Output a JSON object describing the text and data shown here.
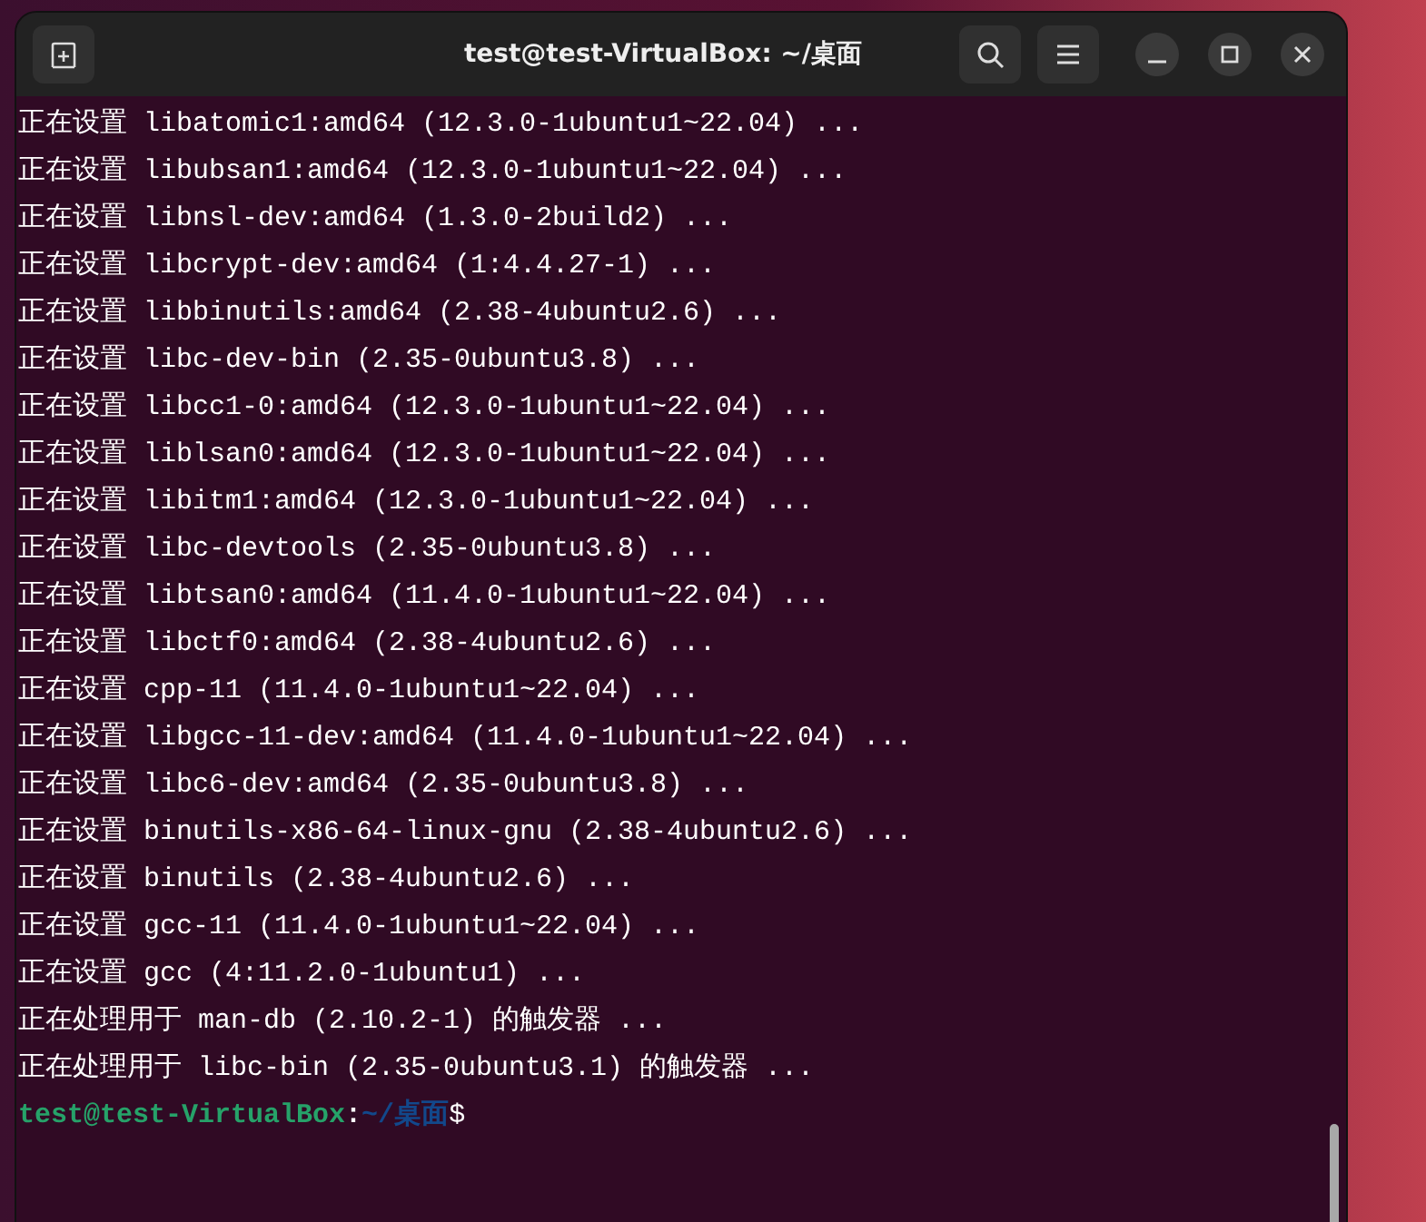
{
  "window": {
    "title": "test@test-VirtualBox: ~/桌面"
  },
  "terminal": {
    "lines": [
      "正在设置 libatomic1:amd64 (12.3.0-1ubuntu1~22.04) ...",
      "正在设置 libubsan1:amd64 (12.3.0-1ubuntu1~22.04) ...",
      "正在设置 libnsl-dev:amd64 (1.3.0-2build2) ...",
      "正在设置 libcrypt-dev:amd64 (1:4.4.27-1) ...",
      "正在设置 libbinutils:amd64 (2.38-4ubuntu2.6) ...",
      "正在设置 libc-dev-bin (2.35-0ubuntu3.8) ...",
      "正在设置 libcc1-0:amd64 (12.3.0-1ubuntu1~22.04) ...",
      "正在设置 liblsan0:amd64 (12.3.0-1ubuntu1~22.04) ...",
      "正在设置 libitm1:amd64 (12.3.0-1ubuntu1~22.04) ...",
      "正在设置 libc-devtools (2.35-0ubuntu3.8) ...",
      "正在设置 libtsan0:amd64 (11.4.0-1ubuntu1~22.04) ...",
      "正在设置 libctf0:amd64 (2.38-4ubuntu2.6) ...",
      "正在设置 cpp-11 (11.4.0-1ubuntu1~22.04) ...",
      "正在设置 libgcc-11-dev:amd64 (11.4.0-1ubuntu1~22.04) ...",
      "正在设置 libc6-dev:amd64 (2.35-0ubuntu3.8) ...",
      "正在设置 binutils-x86-64-linux-gnu (2.38-4ubuntu2.6) ...",
      "正在设置 binutils (2.38-4ubuntu2.6) ...",
      "正在设置 gcc-11 (11.4.0-1ubuntu1~22.04) ...",
      "正在设置 gcc (4:11.2.0-1ubuntu1) ...",
      "正在处理用于 man-db (2.10.2-1) 的触发器 ...",
      "正在处理用于 libc-bin (2.35-0ubuntu3.1) 的触发器 ..."
    ],
    "prompt": {
      "user_host": "test@test-VirtualBox",
      "separator": ":",
      "path": "~/桌面",
      "symbol": "$"
    }
  }
}
